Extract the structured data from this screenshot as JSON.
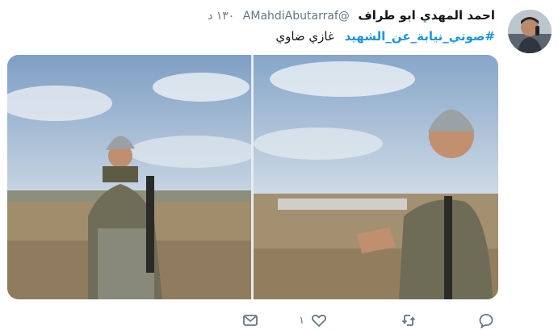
{
  "tweet": {
    "display_name": "احمد المهدي ابو طراف",
    "handle": "@AMahdiAbutarraf",
    "time": "١٣٠ د",
    "hashtag": "#صوتي_نيابة_عن_الشهيد",
    "text_after": "غازي ضاوي"
  },
  "actions": {
    "reply_icon": "reply-icon",
    "retweet_icon": "retweet-icon",
    "like_icon": "heart-icon",
    "like_count": "١",
    "dm_icon": "envelope-icon"
  },
  "colors": {
    "link": "#1b95e0",
    "secondary_text": "#657786",
    "icon": "#657786"
  }
}
